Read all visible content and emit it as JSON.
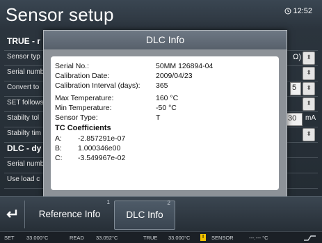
{
  "header": {
    "title": "Sensor setup",
    "time": "12:52"
  },
  "background_rows": [
    {
      "label": "TRUE - r",
      "bold": true
    },
    {
      "label": "Sensor typ",
      "value": "Ω)"
    },
    {
      "label": "Serial numb"
    },
    {
      "label": "Convert to",
      "value": "5"
    },
    {
      "label": "SET follows"
    },
    {
      "label": "Stabilty tol",
      "value": "30",
      "unit": "mA"
    },
    {
      "label": "Stabilty tim"
    },
    {
      "label": "DLC - dy",
      "bold": true
    },
    {
      "label": "Serial numb"
    },
    {
      "label": "Use load c"
    }
  ],
  "dialog": {
    "title": "DLC Info",
    "fields": [
      {
        "label": "Serial No.:",
        "value": "50MM 126894-04"
      },
      {
        "label": "Calibration Date:",
        "value": "2009/04/23"
      },
      {
        "label": "Calibration Interval (days):",
        "value": "365"
      },
      {
        "label": "Max Temperature:",
        "value": "160 °C"
      },
      {
        "label": "Min Temperature:",
        "value": "-50 °C"
      },
      {
        "label": "Sensor Type:",
        "value": "T"
      }
    ],
    "tc_title": "TC Coefficients",
    "tc": [
      {
        "label": "A:",
        "value": "-2.857291e-07"
      },
      {
        "label": "B:",
        "value": "1.000346e00"
      },
      {
        "label": "C:",
        "value": "-3.549967e-02"
      }
    ]
  },
  "tabs": [
    {
      "label": "Reference Info",
      "number": "1",
      "active": false
    },
    {
      "label": "DLC Info",
      "number": "2",
      "active": true
    }
  ],
  "status_bar": {
    "set_label": "SET",
    "set_value": "33.000°C",
    "read_label": "READ",
    "read_value": "33.052°C",
    "true_label": "TRUE",
    "true_value": "33.000°C",
    "sensor_label": "SENSOR",
    "sensor_value": "---.--- °C"
  }
}
